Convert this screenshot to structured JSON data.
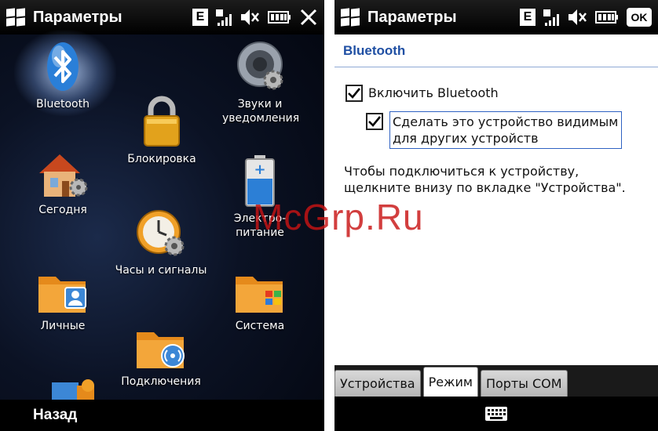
{
  "left": {
    "title": "Параметры",
    "status_e": "E",
    "items": [
      {
        "label": "Bluetooth"
      },
      {
        "label": "Звуки и\nуведомления"
      },
      {
        "label": "Блокировка"
      },
      {
        "label": "Сегодня"
      },
      {
        "label": "Электро-\nпитание"
      },
      {
        "label": "Часы и сигналы"
      },
      {
        "label": "Личные"
      },
      {
        "label": "Система"
      },
      {
        "label": "Подключения"
      }
    ],
    "back_label": "Назад"
  },
  "right": {
    "title": "Параметры",
    "status_e": "E",
    "ok_label": "OK",
    "section_title": "Bluetooth",
    "enable_bluetooth": {
      "label": "Включить Bluetooth",
      "checked": true
    },
    "visible": {
      "label_line1": "Сделать это устройство видимым",
      "label_line2": "для других устройств",
      "checked": true
    },
    "hint_line1": "Чтобы подключиться к устройству,",
    "hint_line2": "щелкните внизу по вкладке \"Устройства\".",
    "tabs": [
      {
        "label": "Устройства",
        "active": false
      },
      {
        "label": "Режим",
        "active": true
      },
      {
        "label": "Порты COM",
        "active": false
      }
    ]
  },
  "watermark": "McGrp.Ru",
  "colors": {
    "section_title": "#1f4fa3",
    "focus_border": "#2f62c2",
    "watermark": "#c81414"
  }
}
